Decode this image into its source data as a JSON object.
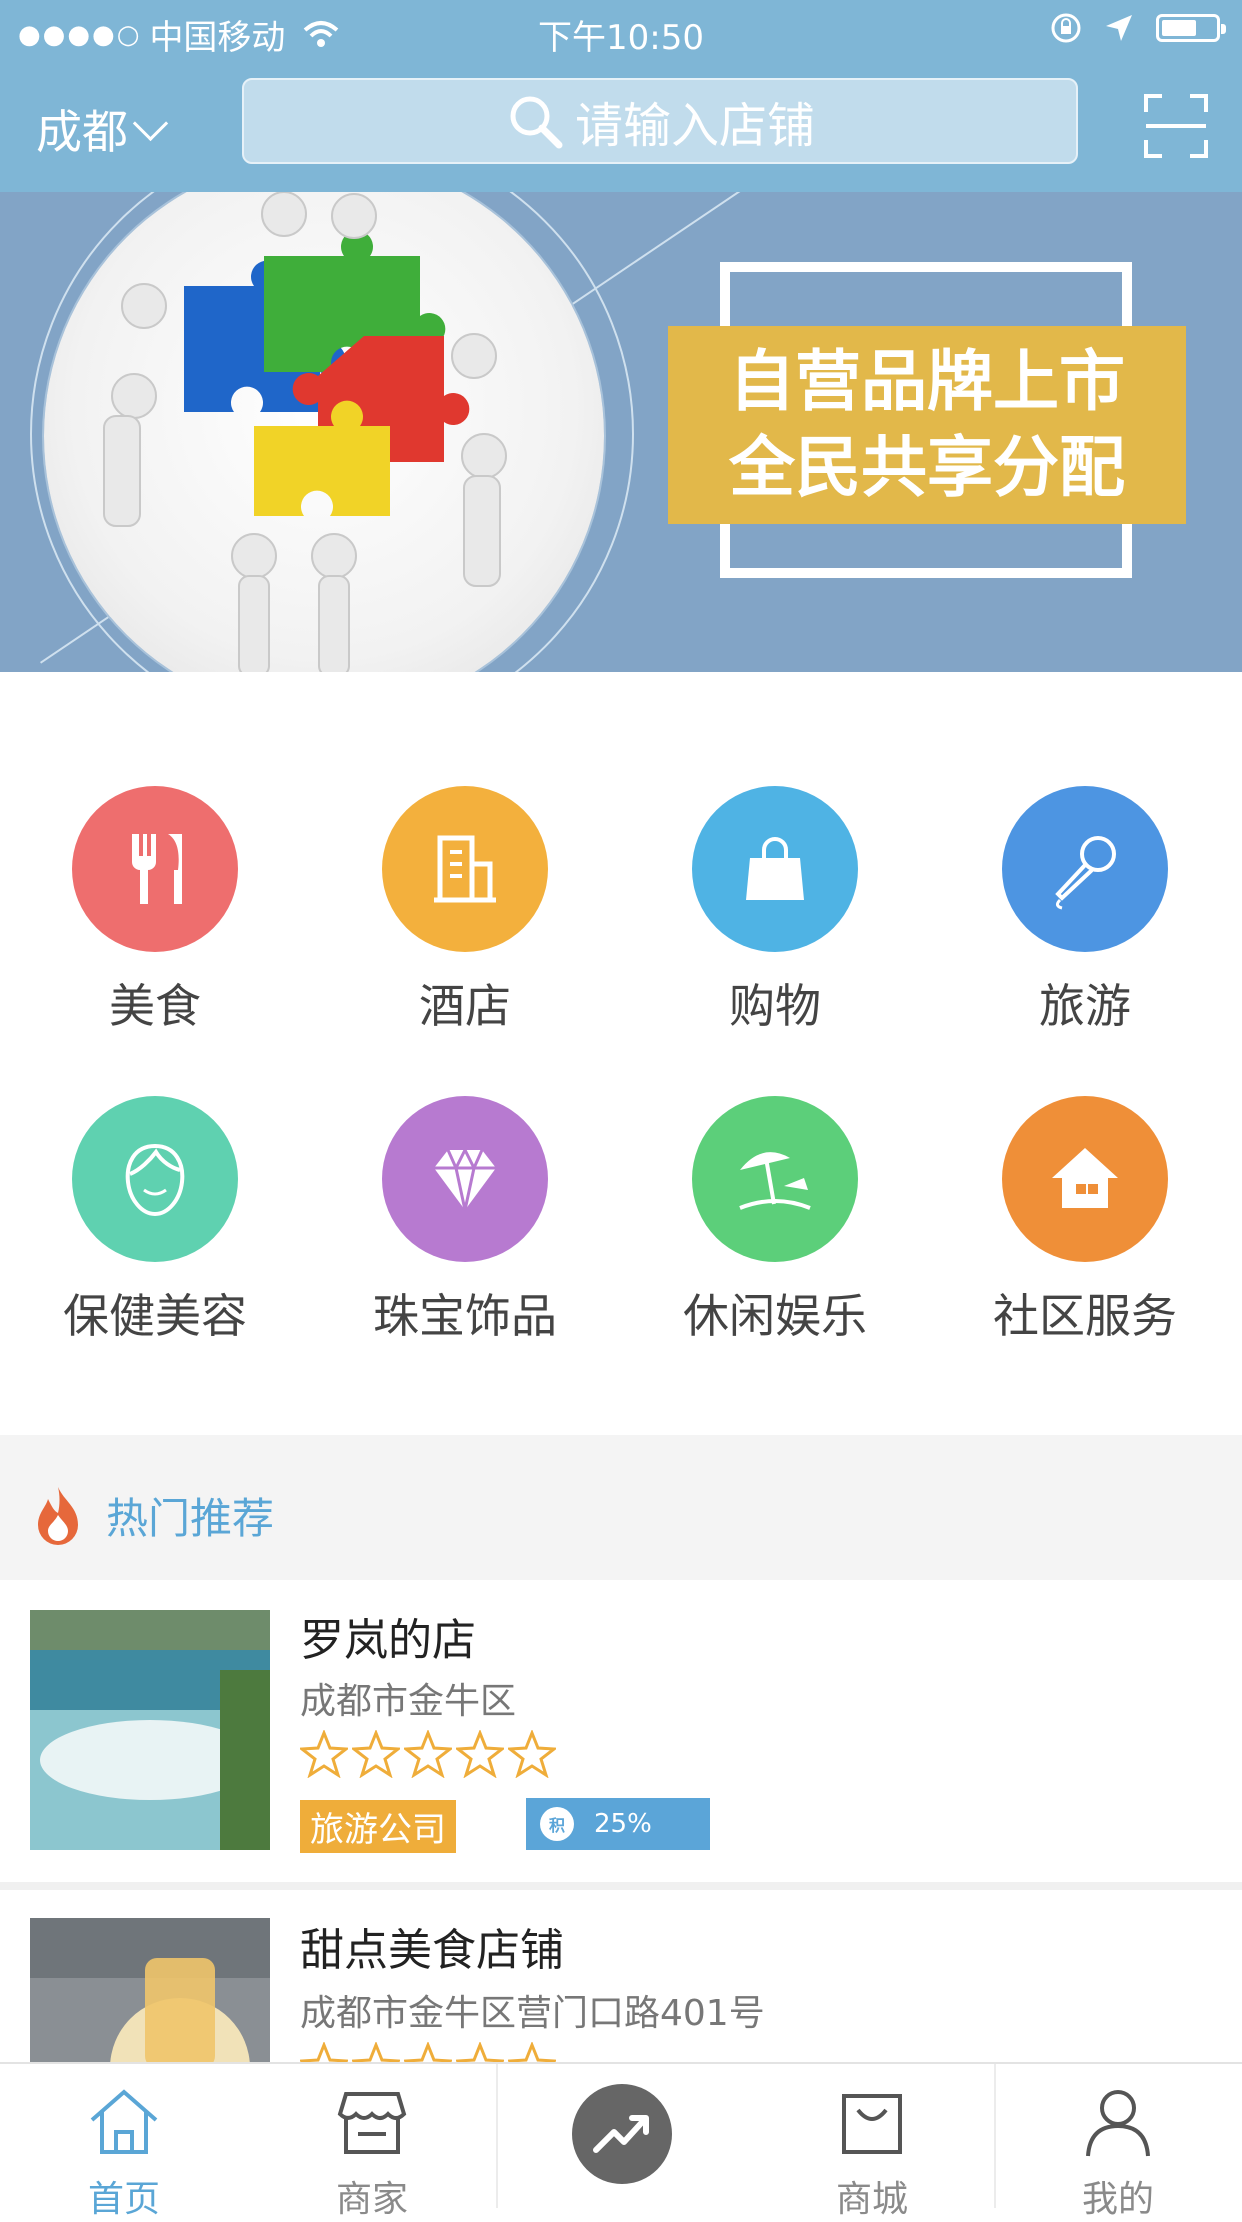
{
  "status_bar": {
    "signal_dots": "●●●●○",
    "carrier": "中国移动",
    "time": "下午10:50",
    "battery_level": 0.55
  },
  "header": {
    "city": "成都",
    "search_placeholder": "请输入店铺"
  },
  "banner": {
    "slogan_line1": "自营品牌上市",
    "slogan_line2": "全民共享分配"
  },
  "categories": [
    {
      "label": "美食",
      "color": "#ee6e6e",
      "icon": "fork-knife-icon"
    },
    {
      "label": "酒店",
      "color": "#f3b03d",
      "icon": "building-icon"
    },
    {
      "label": "购物",
      "color": "#4fb3e4",
      "icon": "shopping-bag-icon"
    },
    {
      "label": "旅游",
      "color": "#4d95e2",
      "icon": "microphone-icon"
    },
    {
      "label": "保健美容",
      "color": "#5fd1b0",
      "icon": "face-icon"
    },
    {
      "label": "珠宝饰品",
      "color": "#b77ad0",
      "icon": "diamond-icon"
    },
    {
      "label": "休闲娱乐",
      "color": "#5ccf7a",
      "icon": "beach-umbrella-icon"
    },
    {
      "label": "社区服务",
      "color": "#ef8f38",
      "icon": "house-icon"
    }
  ],
  "hot": {
    "title": "热门推荐"
  },
  "stores": [
    {
      "name": "罗岚的店",
      "address": "成都市金牛区",
      "rating": 0,
      "max_rating": 5,
      "tag": "旅游公司",
      "badge_letter": "积",
      "percent": "25%"
    },
    {
      "name": "甜点美食店铺",
      "address": "成都市金牛区营门口路401号",
      "rating": 0,
      "max_rating": 5
    }
  ],
  "tabbar": {
    "items": [
      {
        "label": "首页",
        "icon": "home-icon"
      },
      {
        "label": "商家",
        "icon": "store-icon"
      },
      {
        "label": "",
        "icon": "trend-icon"
      },
      {
        "label": "商城",
        "icon": "bag-icon"
      },
      {
        "label": "我的",
        "icon": "person-icon"
      }
    ]
  },
  "colors": {
    "accent": "#7fb6d6",
    "tab_active": "#5aa6d6",
    "star": "#efad3a"
  }
}
